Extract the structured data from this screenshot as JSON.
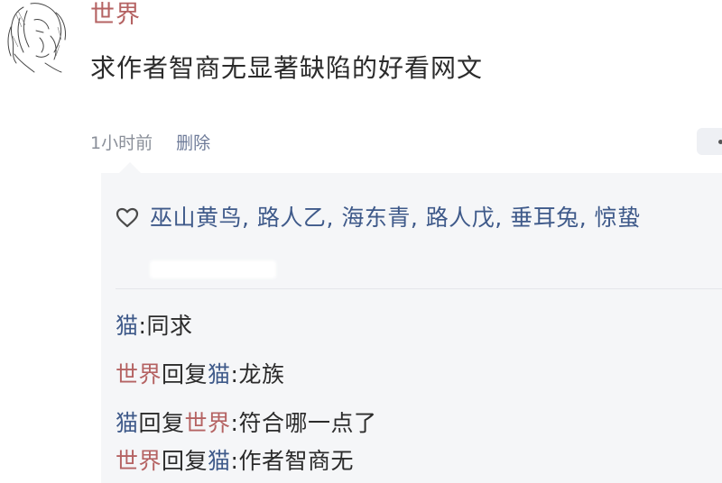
{
  "post": {
    "username": "世界",
    "text": "求作者智商无显著缺陷的好看网文",
    "time": "1小时前",
    "delete_label": "删除"
  },
  "likes": {
    "icon": "heart-icon",
    "names": [
      "巫山黄鸟",
      "路人乙",
      "海东青",
      "路人戊",
      "垂耳兔",
      "惊蛰"
    ],
    "separator": ", "
  },
  "comments": [
    {
      "author": "猫",
      "reply_to": "",
      "text": "同求",
      "author_color": "#3f5a8a"
    },
    {
      "author": "世界",
      "reply_word": "回复",
      "reply_to": "猫",
      "text": "龙族",
      "author_color": "#b56363"
    },
    {
      "author": "猫",
      "reply_word": "回复",
      "reply_to": "世界",
      "text": "符合哪一点了",
      "author_color": "#3f5a8a"
    },
    {
      "author": "世界",
      "reply_word": "回复",
      "reply_to": "猫",
      "text": "作者智商无",
      "author_color": "#b56363"
    }
  ],
  "colors": {
    "username": "#b56363",
    "link_blue": "#3f5a8a",
    "meta_gray": "#8a8f99",
    "box_bg": "#f5f6f8"
  }
}
